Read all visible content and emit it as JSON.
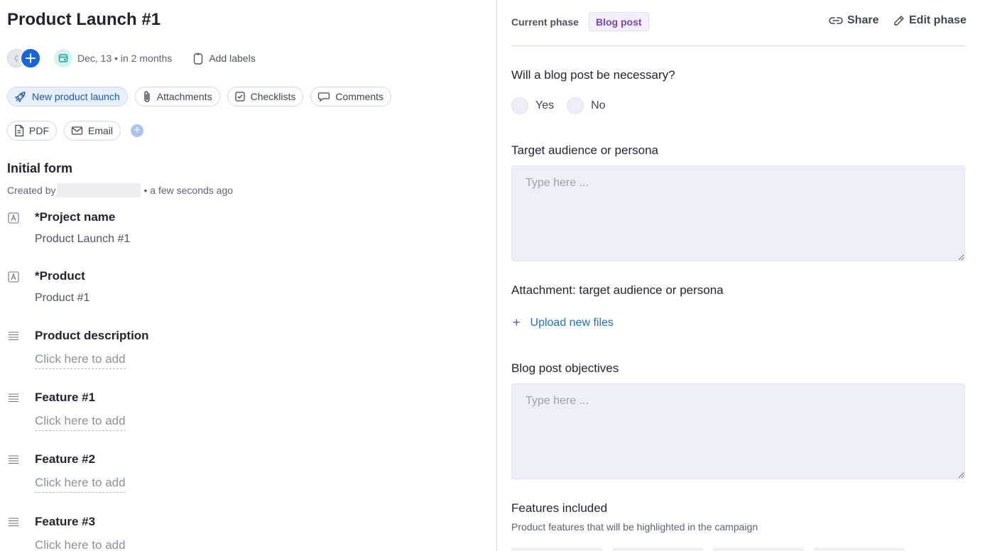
{
  "header": {
    "title": "Product Launch #1",
    "avatar_initial": "ḉ",
    "date_text": "Dec, 13 • in 2 months",
    "add_labels": "Add labels"
  },
  "chips": [
    {
      "label": "New product launch",
      "icon": "rocket-icon"
    },
    {
      "label": "Attachments",
      "icon": "paperclip-icon"
    },
    {
      "label": "Checklists",
      "icon": "checkbox-icon"
    },
    {
      "label": "Comments",
      "icon": "comment-icon"
    },
    {
      "label": "PDF",
      "icon": "file-icon"
    },
    {
      "label": "Email",
      "icon": "mail-icon"
    }
  ],
  "form": {
    "title": "Initial form",
    "created_prefix": "Created by",
    "created_suffix": "• a few seconds ago",
    "fields": [
      {
        "label": "*Project name",
        "value": "Product Launch #1",
        "icon": "text-field-icon"
      },
      {
        "label": "*Product",
        "value": "Product #1",
        "icon": "text-field-icon"
      },
      {
        "label": "Product description",
        "placeholder": "Click here to add",
        "icon": "paragraph-icon"
      },
      {
        "label": "Feature #1",
        "placeholder": "Click here to add",
        "icon": "paragraph-icon"
      },
      {
        "label": "Feature #2",
        "placeholder": "Click here to add",
        "icon": "paragraph-icon"
      },
      {
        "label": "Feature #3",
        "placeholder": "Click here to add",
        "icon": "paragraph-icon"
      }
    ]
  },
  "phase": {
    "label": "Current phase",
    "badge": "Blog post",
    "share": "Share",
    "edit": "Edit phase",
    "badge_color": "#7c3fd6"
  },
  "questions": {
    "blog_necessary": {
      "label": "Will a blog post be necessary?",
      "options": [
        "Yes",
        "No"
      ]
    },
    "target_audience": {
      "label": "Target audience or persona",
      "placeholder": "Type here ..."
    },
    "attachment": {
      "label": "Attachment: target audience or persona",
      "upload": "Upload new files"
    },
    "objectives": {
      "label": "Blog post objectives",
      "placeholder": "Type here ..."
    },
    "features": {
      "label": "Features included",
      "description": "Product features that will be highlighted in the campaign"
    }
  },
  "colors": {
    "accent": "#1565e0",
    "link": "#1a6fd6"
  }
}
